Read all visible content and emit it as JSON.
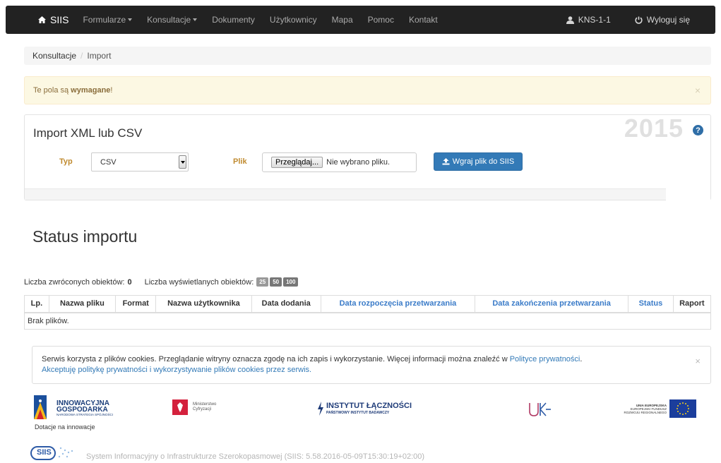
{
  "navbar": {
    "brand": "SIIS",
    "items": [
      {
        "label": "Formularze",
        "dropdown": true
      },
      {
        "label": "Konsultacje",
        "dropdown": true
      },
      {
        "label": "Dokumenty",
        "dropdown": false
      },
      {
        "label": "Użytkownicy",
        "dropdown": false
      },
      {
        "label": "Mapa",
        "dropdown": false
      },
      {
        "label": "Pomoc",
        "dropdown": false
      },
      {
        "label": "Kontakt",
        "dropdown": false
      }
    ],
    "user": "KNS-1-1",
    "logout": "Wyloguj się"
  },
  "breadcrumb": {
    "parent": "Konsultacje",
    "separator": "/",
    "current": "Import"
  },
  "alert": {
    "text": "Te pola są",
    "bold": "wymagane",
    "suffix": "!",
    "close": "×"
  },
  "import_panel": {
    "title": "Import XML lub CSV",
    "year": "2015",
    "help": "?",
    "type_label": "Typ",
    "type_value": "CSV",
    "file_label": "Plik",
    "browse_button": "Przeglądaj...",
    "no_file_text": "Nie wybrano pliku.",
    "upload_button": "Wgraj plik do SIIS"
  },
  "status": {
    "title": "Status importu",
    "returned_label": "Liczba zwróconych obiektów:",
    "returned_count": "0",
    "shown_label": "Liczba wyświetlanych obiektów:",
    "page_sizes": [
      "25",
      "50",
      "100"
    ]
  },
  "table": {
    "headers": [
      "Lp.",
      "Nazwa pliku",
      "Format",
      "Nazwa użytkownika",
      "Data dodania",
      "Data rozpoczęcia przetwarzania",
      "Data zakończenia przetwarzania",
      "Status",
      "Raport"
    ],
    "empty_text": "Brak plików."
  },
  "cookie": {
    "text": "Serwis korzysta z plików cookies. Przeglądanie witryny oznacza zgodę na ich zapis i wykorzystanie. Więcej informacji można znaleźć w",
    "policy_link": "Polityce prywatności",
    "period": ".",
    "accept_link": "Akceptuję politykę prywatności i wykorzystywanie plików cookies przez serwis.",
    "close": "×"
  },
  "footer": {
    "ig_line1": "INNOWACYJNA",
    "ig_line2": "GOSPODARKA",
    "ig_line3": "NARODOWA STRATEGIA SPÓJNOŚCI",
    "ig_caption": "Dotacje na innowacje",
    "mc_line1": "Ministerstwo",
    "mc_line2": "Cyfryzacji",
    "il_line1": "INSTYTUT ŁĄCZNOŚCI",
    "il_line2": "PAŃSTWOWY INSTYTUT BADAWCZY",
    "eu_line1": "UNIA EUROPEJSKA",
    "eu_line2": "EUROPEJSKI FUNDUSZ",
    "eu_line3": "ROZWOJU REGIONALNEGO",
    "siis_logo": "SIIS",
    "system_text": "System Informacyjny o Infrastrukturze Szerokopasmowej",
    "version_text": "(SIIS: 5.58.2016-05-09T15:30:19+02:00)"
  },
  "colors": {
    "navbar": "#222222",
    "primary": "#337ab7",
    "warning_text": "#8a6d3b",
    "label": "#c08b30"
  }
}
